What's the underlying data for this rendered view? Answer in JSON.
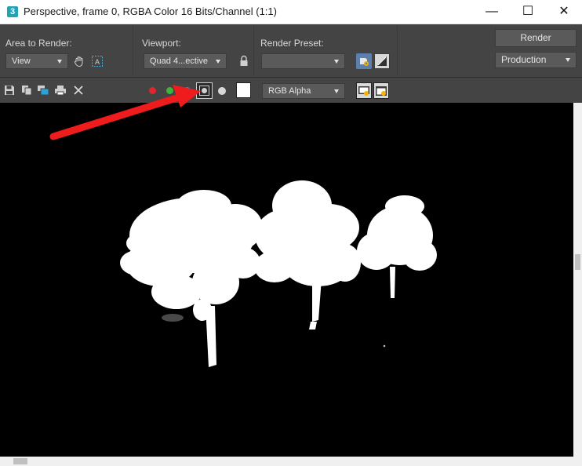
{
  "window": {
    "app_icon_label": "3",
    "title": "Perspective, frame 0, RGBA Color 16 Bits/Channel (1:1)",
    "controls": {
      "minimize": "—",
      "maximize": "☐",
      "close": "✕"
    }
  },
  "render_settings": {
    "area_to_render": {
      "label": "Area to Render:",
      "value": "View"
    },
    "viewport": {
      "label": "Viewport:",
      "value": "Quad 4...ective"
    },
    "render_preset": {
      "label": "Render Preset:",
      "value": ""
    },
    "render_button": "Render",
    "production": {
      "value": "Production"
    }
  },
  "toolbar": {
    "channel_display": {
      "value": "RGB Alpha"
    },
    "channel_colors": {
      "red": "#e0262c",
      "green": "#3db43d",
      "blue": "#1e9bd7",
      "mono": "#d9d9d9"
    }
  },
  "annotation": {
    "arrow_color": "#ee1c1c"
  },
  "viewport": {
    "background": "#000000",
    "content": "white tree silhouettes (alpha channel)"
  }
}
